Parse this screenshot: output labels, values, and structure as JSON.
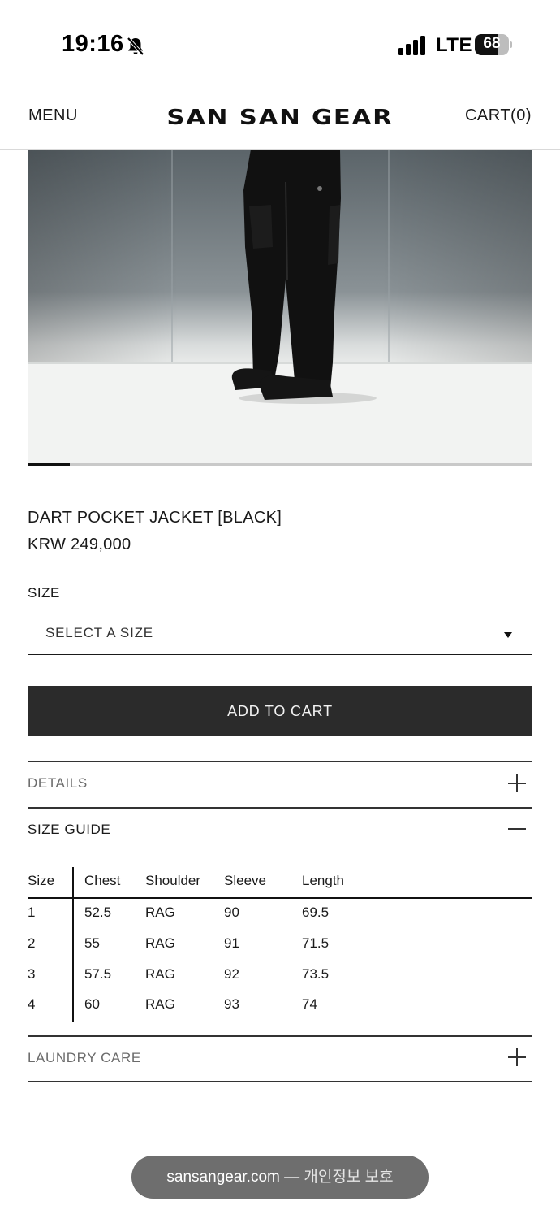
{
  "status_bar": {
    "time": "19:16",
    "network": "LTE",
    "battery_percent": "68",
    "battery_level": 0.68
  },
  "header": {
    "menu_label": "MENU",
    "brand": "SAN SAN GEAR",
    "cart_label": "CART(0)"
  },
  "gallery": {
    "progress_fraction": 0.083
  },
  "product": {
    "name": "DART POCKET JACKET [BLACK]",
    "price": "KRW 249,000"
  },
  "size_selector": {
    "label": "SIZE",
    "placeholder": "SELECT A SIZE"
  },
  "add_to_cart_label": "ADD TO CART",
  "accordions": {
    "details": "DETAILS",
    "size_guide": "SIZE GUIDE",
    "laundry_care": "LAUNDRY CARE"
  },
  "size_table": {
    "headers": [
      "Size",
      "Chest",
      "Shoulder",
      "Sleeve",
      "Length"
    ],
    "rows": [
      [
        "1",
        "52.5",
        "RAG",
        "90",
        "69.5"
      ],
      [
        "2",
        "55",
        "RAG",
        "91",
        "71.5"
      ],
      [
        "3",
        "57.5",
        "RAG",
        "92",
        "73.5"
      ],
      [
        "4",
        "60",
        "RAG",
        "93",
        "74"
      ]
    ]
  },
  "browser_toast": {
    "domain": "sansangear.com",
    "separator": " — ",
    "suffix": "개인정보 보호"
  },
  "colors": {
    "button_bg": "#2b2b2b",
    "text": "#1a1a1a",
    "muted_text": "#6b6b6b"
  }
}
